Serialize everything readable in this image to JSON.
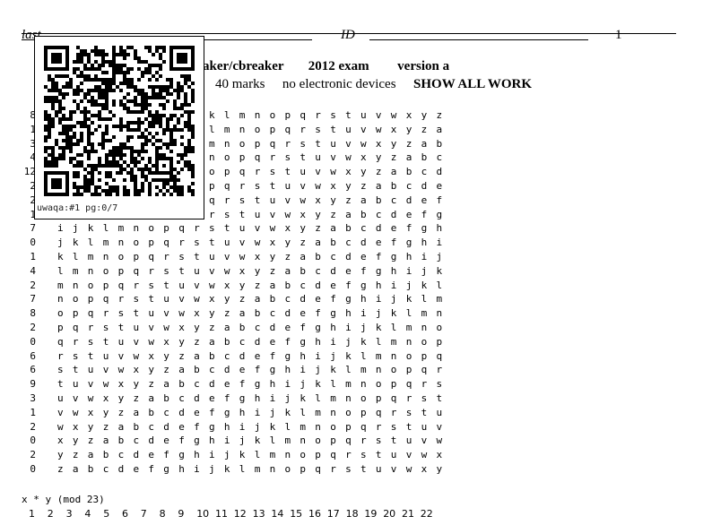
{
  "header": {
    "last_label": "last",
    "id_label": "ID",
    "page_number": "1"
  },
  "title": {
    "course": "aker/cbreaker",
    "exam": "2012 exam",
    "version": "version a"
  },
  "subtitle": {
    "marks": "40 marks",
    "devices": "no electronic devices",
    "show_work": "SHOW ALL WORK"
  },
  "qr": {
    "caption": "uwaqa:#1 pg:0/7"
  },
  "table": {
    "left_numbers": [
      "8",
      "1",
      "3",
      "4",
      "12",
      "2",
      "2",
      "1",
      "7",
      "0",
      "1",
      "4",
      "2",
      "7",
      "8",
      "2",
      "0",
      "6",
      "6",
      "9",
      "3",
      "1",
      "2",
      "0",
      "2",
      "0"
    ],
    "rows": [
      "abcdefghijklmnopqrstuvwxyz",
      "bcdefghijklmnopqrstuvwxyza",
      "cdefghijklmnopqrstuvwxyzab",
      "defghijklmnopqrstuvwxyzabc",
      "efghijklmnopqrstuvwxyzabcd",
      "fghijklmnopqrstuvwxyzabcde",
      "ghijklmnopqrstuvwxyzabcdef",
      "hijklmnopqrstuvwxyzabcdefg",
      "ijklmnopqrstuvwxyzabcdefgh",
      "jklmnopqrstuvwxyzabcdefghi",
      "klmnopqrstuvwxyzabcdefghij",
      "lmnopqrstuvwxyzabcdefghijk",
      "mnopqrstuvwxyzabcdefghijkl",
      "nopqrstuvwxyzabcdefghijklm",
      "opqrstuvwxyzabcdefghijklmn",
      "pqrstuvwxyzabcdefghijklmno",
      "qrstuvwxyzabcdefghijklmnop",
      "rstuvwxyzabcdefghijklmnopq",
      "stuvwxyzabcdefghijklmnopqr",
      "tuvwxyzabcdefghijklmnopqrs",
      "uvwxyzabcdefghijklmnopqrst",
      "vwxyzabcdefghijklmnopqrstu",
      "wxyzabcdefghijklmnopqrstuv",
      "xyzabcdefghijklmnopqrstuvw",
      "yzabcdefghijklmnopqrstuvwx",
      "zabcdefghijklmnopqrstuvwxy"
    ]
  },
  "mod_table": {
    "label": "x * y (mod 23)",
    "headers": [
      "1",
      "2",
      "3",
      "4",
      "5",
      "6",
      "7",
      "8",
      "9",
      "10",
      "11",
      "12",
      "13",
      "14",
      "15",
      "16",
      "17",
      "18",
      "19",
      "20",
      "21",
      "22"
    ]
  }
}
